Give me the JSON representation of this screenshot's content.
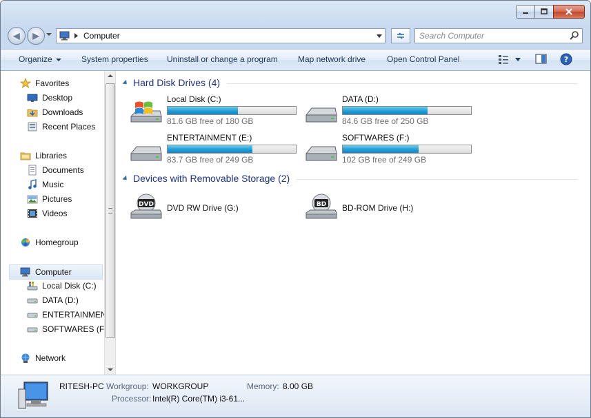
{
  "window": {
    "address_path": "Computer",
    "search_placeholder": "Search Computer"
  },
  "toolbar": {
    "organize": "Organize",
    "system_properties": "System properties",
    "uninstall": "Uninstall or change a program",
    "map_drive": "Map network drive",
    "control_panel": "Open Control Panel"
  },
  "nav": {
    "favorites": "Favorites",
    "desktop": "Desktop",
    "downloads": "Downloads",
    "recent": "Recent Places",
    "libraries": "Libraries",
    "documents": "Documents",
    "music": "Music",
    "pictures": "Pictures",
    "videos": "Videos",
    "homegroup": "Homegroup",
    "computer": "Computer",
    "local_c": "Local Disk (C:)",
    "data_d": "DATA (D:)",
    "ent_e": "ENTERTAINMENT",
    "soft_f": "SOFTWARES (F:)",
    "network": "Network"
  },
  "groups": {
    "hdd": "Hard Disk Drives (4)",
    "removable": "Devices with Removable Storage (2)"
  },
  "drives": [
    {
      "name": "Local Disk (C:)",
      "free": "81.6 GB free of 180 GB",
      "used_fraction": 0.55
    },
    {
      "name": "DATA (D:)",
      "free": "84.6 GB free of 250 GB",
      "used_fraction": 0.66
    },
    {
      "name": "ENTERTAINMENT (E:)",
      "free": "83.7 GB free of 249 GB",
      "used_fraction": 0.66
    },
    {
      "name": "SOFTWARES (F:)",
      "free": "102 GB free of 249 GB",
      "used_fraction": 0.59
    }
  ],
  "removable": [
    {
      "name": "DVD RW Drive (G:)",
      "badge": "DVD"
    },
    {
      "name": "BD-ROM Drive (H:)",
      "badge": "BD"
    }
  ],
  "details": {
    "pc_name": "RITESH-PC",
    "workgroup_label": "Workgroup:",
    "workgroup": "WORKGROUP",
    "memory_label": "Memory:",
    "memory": "8.00 GB",
    "processor_label": "Processor:",
    "processor": "Intel(R) Core(TM) i3-61..."
  },
  "colors": {
    "bar_fill": "#26a0da",
    "group_title": "#1e3287",
    "toolbar_text": "#1e395b"
  }
}
